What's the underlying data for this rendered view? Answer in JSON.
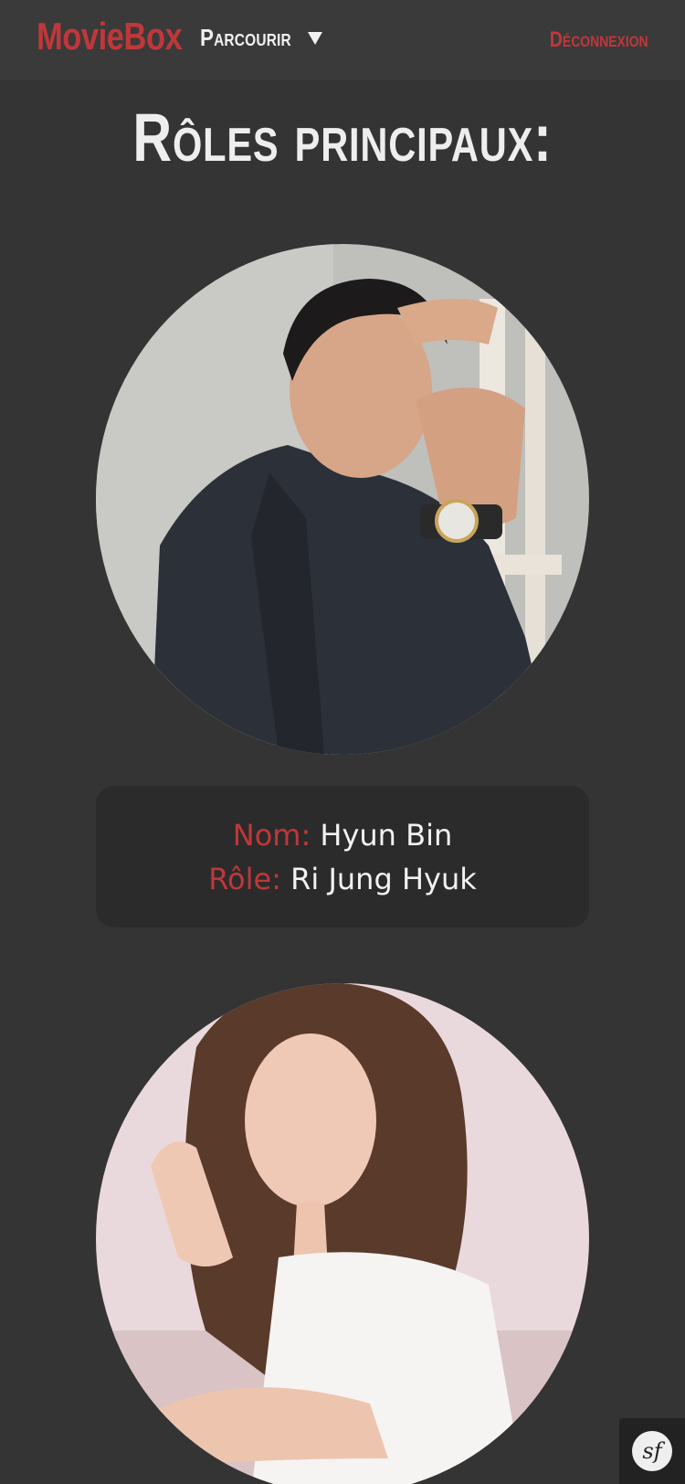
{
  "navbar": {
    "brand": "MovieBox",
    "browse_label": "Parcourir",
    "browse_icon": "caret-down-icon",
    "logout_label": "Déconnexion"
  },
  "page": {
    "title": "Rôles principaux:"
  },
  "cast": [
    {
      "name_key": "Nom:",
      "name": "Hyun Bin",
      "role_key": "Rôle:",
      "role": "Ri Jung Hyuk"
    }
  ],
  "debug_toolbar": {
    "logo_text": "sf",
    "icon": "symfony-icon"
  },
  "colors": {
    "accent": "#c0373a",
    "background": "#343434",
    "navbar": "#3a3a3a",
    "card": "#2b2b2b",
    "text": "#f2f2f2"
  }
}
